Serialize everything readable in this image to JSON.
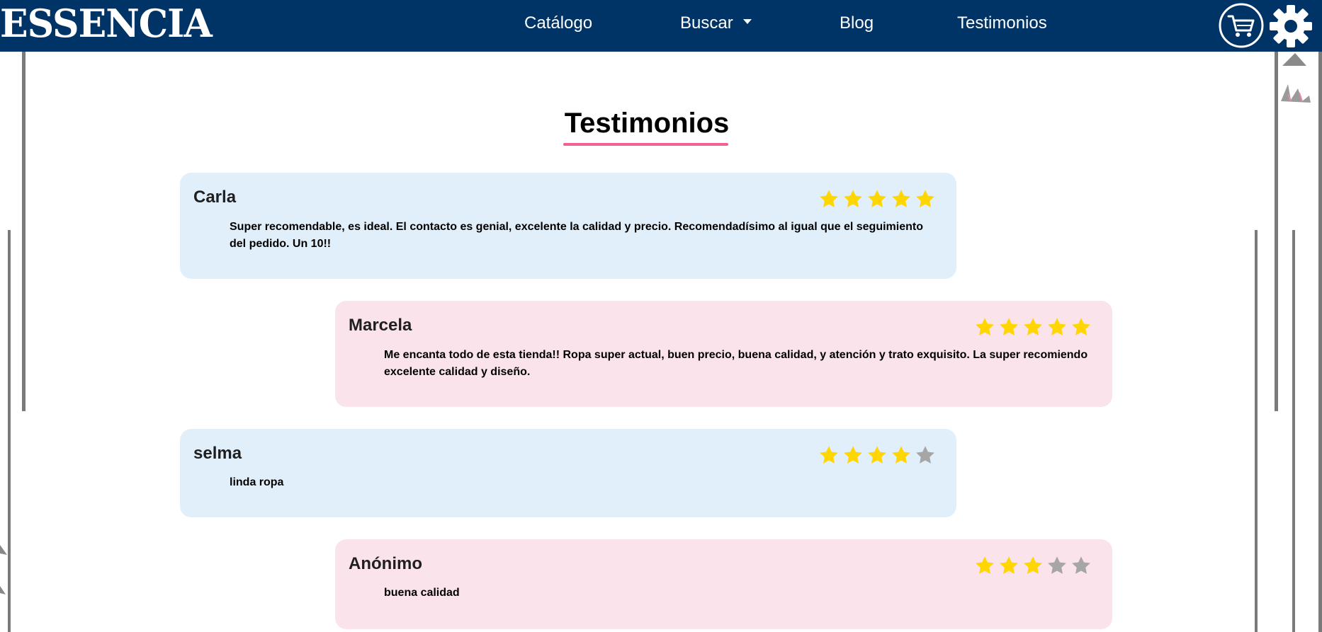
{
  "header": {
    "brand": "ESSENCIA",
    "nav": [
      {
        "label": "Catálogo"
      },
      {
        "label": "Buscar"
      },
      {
        "label": "Blog"
      },
      {
        "label": "Testimonios"
      }
    ],
    "icons": {
      "cart": "shopping-cart-icon",
      "settings": "gear-icon"
    },
    "colors": {
      "background": "#003366",
      "text": "#ffffff"
    }
  },
  "page": {
    "title": "Testimonios",
    "accent_color": "#f06292"
  },
  "testimonials": [
    {
      "name": "Carla",
      "rating": 5,
      "text": "Super recomendable, es ideal. El contacto es genial, excelente la calidad y precio. Recomendadísimo al igual que el seguimiento del pedido. Un 10!!",
      "color": "#e1effb"
    },
    {
      "name": "Marcela",
      "rating": 5,
      "text": "Me encanta todo de esta tienda!! Ropa super actual, buen precio, buena calidad, y atención y trato exquisito. La super recomiendo excelente calidad y diseño.",
      "color": "#fae3ea"
    },
    {
      "name": "selma",
      "rating": 4,
      "text": "linda ropa",
      "color": "#e1effb"
    },
    {
      "name": "Anónimo",
      "rating": 3,
      "text": "buena calidad",
      "color": "#fae3ea"
    }
  ],
  "rating_max": 5,
  "star_colors": {
    "filled": "#ffd600",
    "empty": "#a6a6a6"
  }
}
